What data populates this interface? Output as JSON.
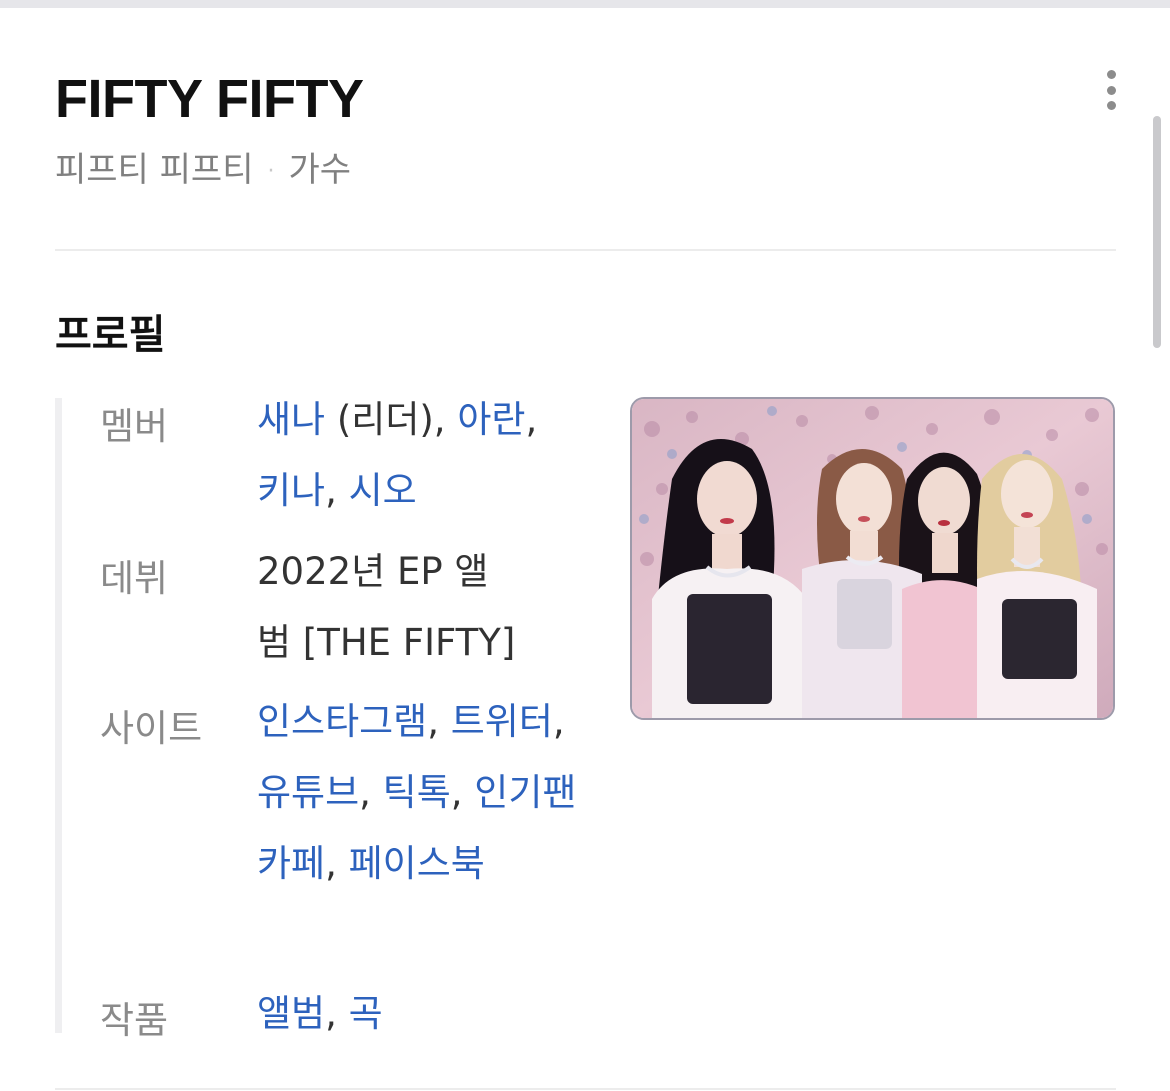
{
  "header": {
    "title": "FIFTY FIFTY",
    "subtitle_name": "피프티 피프티",
    "subtitle_separator": "·",
    "subtitle_category": "가수",
    "more_icon": "more-vertical-icon"
  },
  "profile": {
    "section_title": "프로필",
    "rows": {
      "members": {
        "label": "멤버",
        "items": [
          "새나",
          "(리더), ",
          "아란",
          ", ",
          "키나",
          ", ",
          "시오"
        ]
      },
      "debut": {
        "label": "데뷔",
        "text_line1": "2022년 EP 앨",
        "text_line2": "범 [THE FIFTY]"
      },
      "sites": {
        "label": "사이트",
        "items": [
          "인스타그램",
          ", ",
          "트위터",
          ", ",
          "유튜브",
          ", ",
          "틱톡",
          ", ",
          "인기팬카페",
          ", ",
          "페이스북"
        ]
      },
      "works": {
        "label": "작품",
        "items": [
          "앨범",
          ", ",
          "곡"
        ]
      }
    },
    "photo_alt": "FIFTY FIFTY group photo"
  },
  "colors": {
    "link": "#2d62bd",
    "label": "#8a8a8a",
    "title": "#111111"
  }
}
